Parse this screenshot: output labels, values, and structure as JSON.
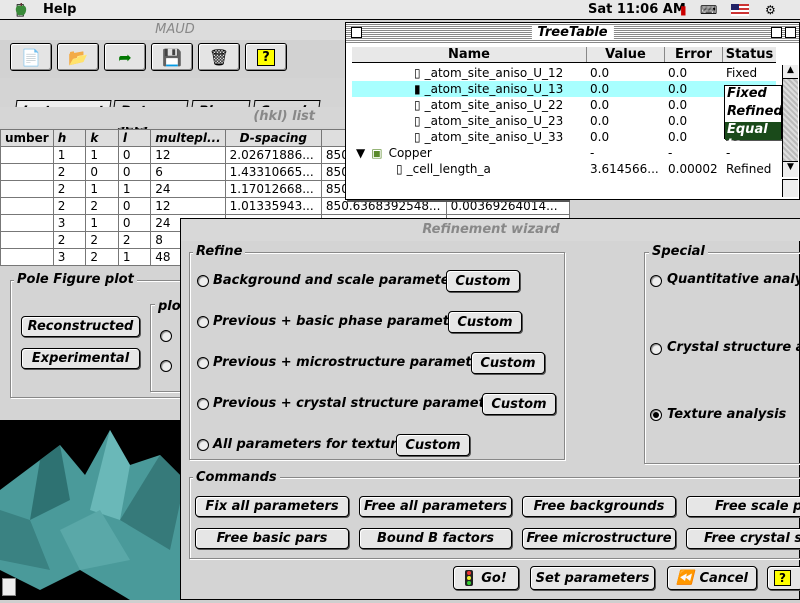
{
  "menubar": {
    "apple": "",
    "help": "Help",
    "clock": "Sat 11:06 AM"
  },
  "maud": {
    "title": "MAUD",
    "tabs": [
      "Instruments",
      "Data sets",
      "Phases",
      "Samples"
    ],
    "hkl_title": "(hkl) list",
    "table": {
      "headers": [
        "umber",
        "h",
        "k",
        "l",
        "multepl...",
        "D-spacing"
      ],
      "rows": [
        [
          "",
          "1",
          "1",
          "0",
          "12",
          "2.02671886...",
          "850"
        ],
        [
          "",
          "2",
          "0",
          "0",
          "6",
          "1.43310665...",
          "850"
        ],
        [
          "",
          "2",
          "1",
          "1",
          "24",
          "1.17012668...",
          "850"
        ],
        [
          "",
          "2",
          "2",
          "0",
          "12",
          "1.01335943...",
          "850.6368392548...",
          "0.00369264014..."
        ],
        [
          "",
          "3",
          "1",
          "0",
          "24",
          "",
          ""
        ],
        [
          "",
          "2",
          "2",
          "2",
          "8",
          "",
          ""
        ],
        [
          "",
          "3",
          "2",
          "1",
          "48",
          "",
          ""
        ]
      ]
    },
    "pole_figure": {
      "title": "Pole Figure plot",
      "reconstructed": "Reconstructed",
      "experimental": "Experimental",
      "plot_label": "plo"
    }
  },
  "tree": {
    "title": "TreeTable",
    "headers": {
      "name": "Name",
      "value": "Value",
      "error": "Error",
      "status": "Status"
    },
    "rows": [
      {
        "name": "_atom_site_aniso_U_12",
        "value": "0.0",
        "error": "0.0",
        "status": "Fixed"
      },
      {
        "name": "_atom_site_aniso_U_13",
        "value": "0.0",
        "error": "0.0",
        "status": ""
      },
      {
        "name": "_atom_site_aniso_U_22",
        "value": "0.0",
        "error": "0.0",
        "status": ""
      },
      {
        "name": "_atom_site_aniso_U_23",
        "value": "0.0",
        "error": "0.0",
        "status": ""
      },
      {
        "name": "_atom_site_aniso_U_33",
        "value": "0.0",
        "error": "0.0",
        "status": ""
      },
      {
        "name": "Copper",
        "value": "-",
        "error": "-",
        "status": "-"
      },
      {
        "name": "_cell_length_a",
        "value": "3.614566...",
        "error": "0.00002",
        "status": "Refined"
      }
    ],
    "status_menu": [
      "Fixed",
      "Refined",
      "Equal to"
    ]
  },
  "wizard": {
    "title": "Refinement wizard",
    "refine_label": "Refine",
    "custom": "Custom",
    "options": [
      "Background and scale parameters",
      "Previous + basic phase parameters",
      "Previous + microstructure parameters",
      "Previous + crystal structure parameters",
      "All parameters for texture"
    ],
    "special_label": "Special",
    "special": [
      "Quantitative analysis",
      "Crystal structure and",
      "Texture analysis"
    ],
    "commands_label": "Commands",
    "commands_row1": [
      "Fix all parameters",
      "Free all parameters",
      "Free backgrounds",
      "Free scale pa"
    ],
    "commands_row2": [
      "Free basic pars",
      "Bound B factors",
      "Free microstructure",
      "Free crystal str"
    ],
    "go": "Go!",
    "set_parameters": "Set parameters",
    "cancel": "Cancel"
  }
}
